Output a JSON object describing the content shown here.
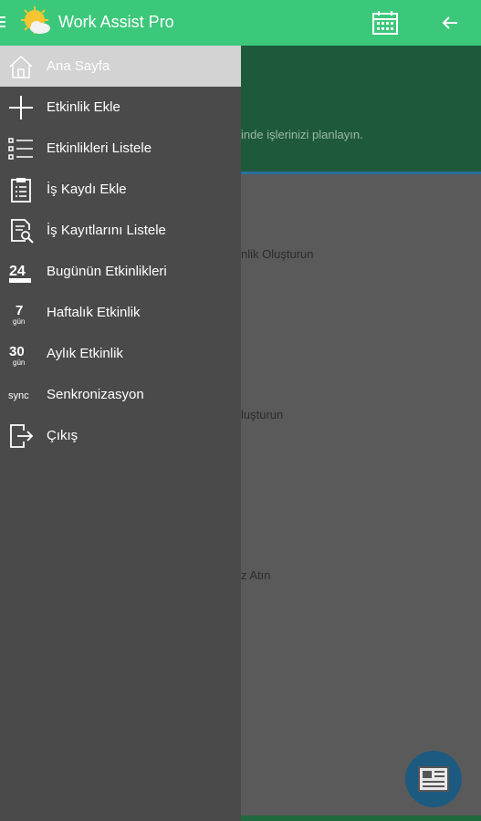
{
  "app": {
    "title": "Work Assist Pro",
    "accent": "#3cc87a"
  },
  "menu": [
    {
      "label": "Ana Sayfa",
      "icon": "home-icon",
      "active": true
    },
    {
      "label": "Etkinlik Ekle",
      "icon": "plus-icon"
    },
    {
      "label": "Etkinlikleri Listele",
      "icon": "list-icon"
    },
    {
      "label": "İş Kaydı Ekle",
      "icon": "clipboard-icon"
    },
    {
      "label": "İş Kayıtlarını Listele",
      "icon": "document-search-icon"
    },
    {
      "label": "Bugünün Etkinlikleri",
      "icon": "24-hours-icon"
    },
    {
      "label": "Haftalık Etkinlik",
      "icon": "7-day-icon"
    },
    {
      "label": "Aylık Etkinlik",
      "icon": "30-day-icon"
    },
    {
      "label": "Senkronizasyon",
      "icon": "sync-icon"
    },
    {
      "label": "Çıkış",
      "icon": "logout-icon"
    }
  ],
  "background": {
    "tagline": "inde işlerinizi planlayın.",
    "card1": "nlik Oluşturun",
    "card2": "luşturun",
    "card3": "z Atın"
  }
}
